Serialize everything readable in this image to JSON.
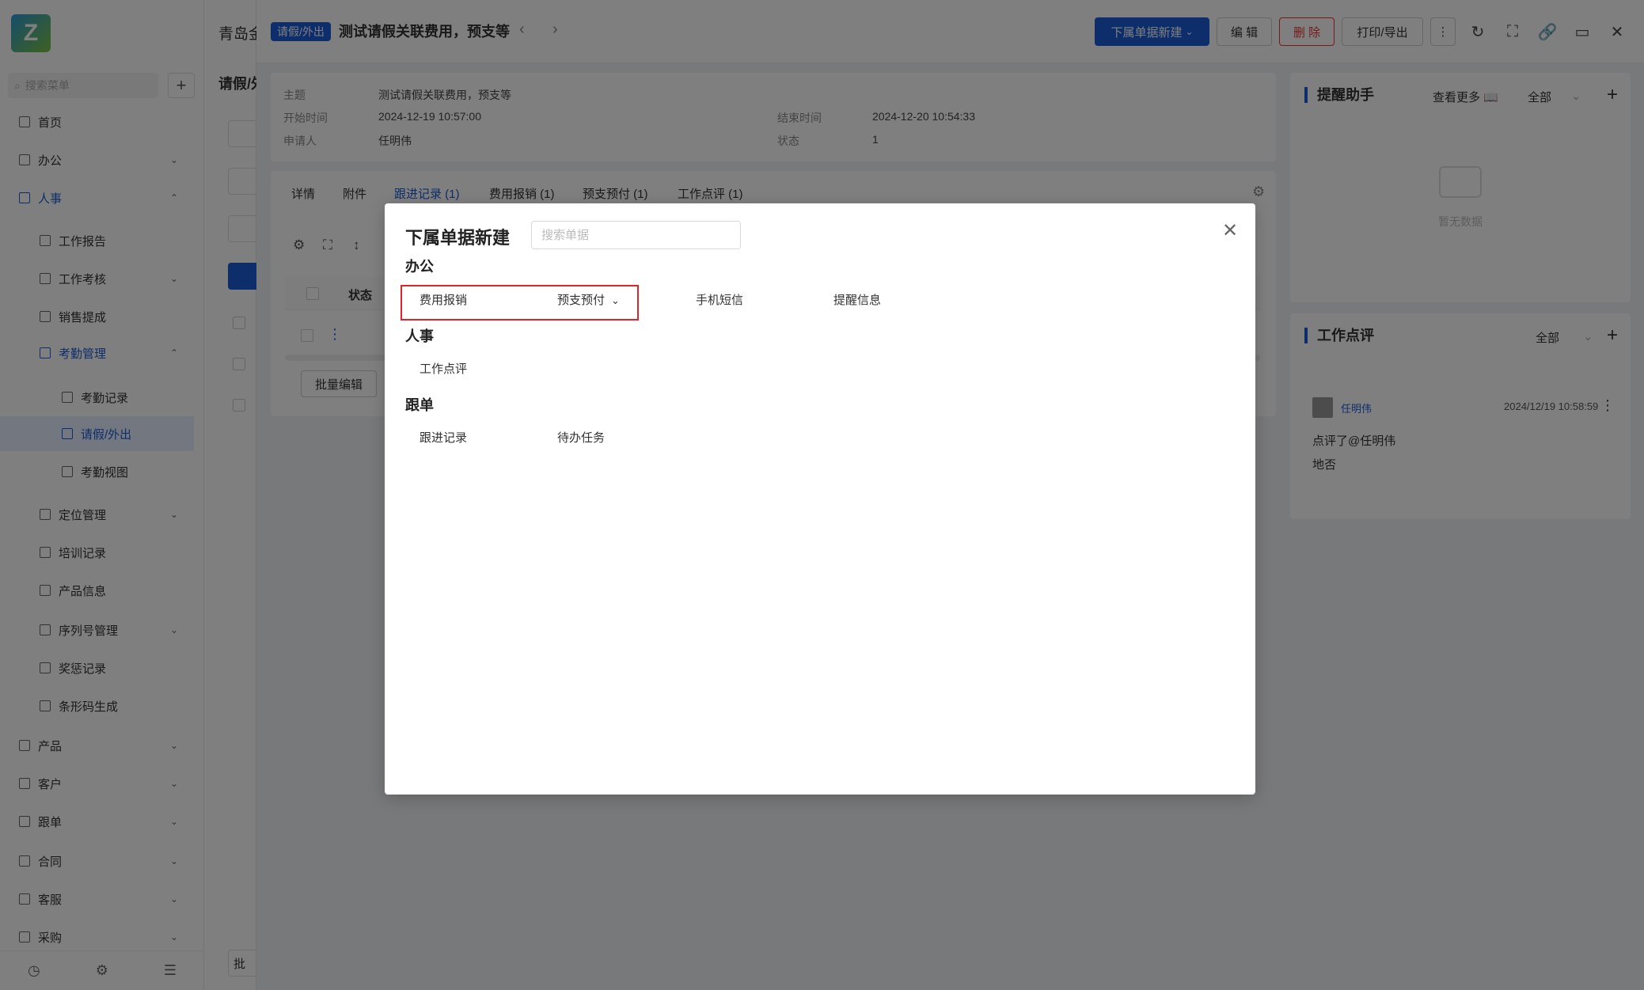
{
  "sidebar": {
    "logo": "Z",
    "search_placeholder": "搜索菜单",
    "add_label": "+",
    "items": [
      {
        "label": "首页",
        "icon": "home-icon",
        "expandable": false
      },
      {
        "label": "办公",
        "icon": "office-icon",
        "expandable": true
      },
      {
        "label": "人事",
        "icon": "hr-icon",
        "expandable": true,
        "expanded": true
      },
      {
        "label": "工作报告",
        "icon": "report-icon",
        "expandable": false
      },
      {
        "label": "工作考核",
        "icon": "assess-icon",
        "expandable": true
      },
      {
        "label": "销售提成",
        "icon": "commission-icon",
        "expandable": false
      },
      {
        "label": "考勤管理",
        "icon": "attendance-icon",
        "expandable": true,
        "expanded": true
      },
      {
        "label": "考勤记录",
        "icon": "record-icon",
        "expandable": false
      },
      {
        "label": "请假/外出",
        "icon": "leave-icon",
        "expandable": false,
        "selected": true
      },
      {
        "label": "考勤视图",
        "icon": "view-icon",
        "expandable": false
      },
      {
        "label": "定位管理",
        "icon": "location-icon",
        "expandable": true
      },
      {
        "label": "培训记录",
        "icon": "training-icon",
        "expandable": false
      },
      {
        "label": "产品信息",
        "icon": "product-info-icon",
        "expandable": false
      },
      {
        "label": "序列号管理",
        "icon": "serial-icon",
        "expandable": true
      },
      {
        "label": "奖惩记录",
        "icon": "reward-icon",
        "expandable": false
      },
      {
        "label": "条形码生成",
        "icon": "barcode-icon",
        "expandable": false
      },
      {
        "label": "产品",
        "icon": "product-icon",
        "expandable": true
      },
      {
        "label": "客户",
        "icon": "customer-icon",
        "expandable": true
      },
      {
        "label": "跟单",
        "icon": "follow-icon",
        "expandable": true
      },
      {
        "label": "合同",
        "icon": "contract-icon",
        "expandable": true
      },
      {
        "label": "客服",
        "icon": "service-icon",
        "expandable": true
      },
      {
        "label": "采购",
        "icon": "purchase-icon",
        "expandable": true
      }
    ]
  },
  "list": {
    "title": "青岛金",
    "subtitle": "请假/外",
    "batch_label": "批"
  },
  "header": {
    "tag": "请假/外出",
    "title": "测试请假关联费用，预支等",
    "new_child_btn": "下属单据新建",
    "edit_btn": "编 辑",
    "delete_btn": "删 除",
    "print_btn": "打印/导出"
  },
  "info": {
    "subject_label": "主题",
    "subject": "测试请假关联费用，预支等",
    "start_label": "开始时间",
    "start": "2024-12-19 10:57:00",
    "end_label": "结束时间",
    "end": "2024-12-20 10:54:33",
    "applicant_label": "申请人",
    "applicant": "任明伟",
    "status_label": "状态",
    "status": "1"
  },
  "tabs": [
    {
      "label": "详情",
      "active": false
    },
    {
      "label": "附件",
      "active": false
    },
    {
      "label": "跟进记录 (1)",
      "active": true
    },
    {
      "label": "费用报销 (1)",
      "active": false
    },
    {
      "label": "预支预付 (1)",
      "active": false
    },
    {
      "label": "工作点评 (1)",
      "active": false
    }
  ],
  "table": {
    "status_header": "状态",
    "batch_edit": "批量编辑"
  },
  "reminder": {
    "title": "提醒助手",
    "more": "查看更多",
    "filter": "全部",
    "empty": "暂无数据"
  },
  "review": {
    "title": "工作点评",
    "filter": "全部",
    "user": "任明伟",
    "time": "2024/12/19 10:58:59",
    "line1": "点评了@任明伟",
    "line2": "地否"
  },
  "modal": {
    "title": "下属单据新建",
    "search_placeholder": "搜索单据",
    "groups": [
      {
        "title": "办公",
        "items": [
          "费用报销",
          "预支预付",
          "手机短信",
          "提醒信息"
        ]
      },
      {
        "title": "人事",
        "items": [
          "工作点评"
        ]
      },
      {
        "title": "跟单",
        "items": [
          "跟进记录",
          "待办任务"
        ]
      }
    ]
  }
}
